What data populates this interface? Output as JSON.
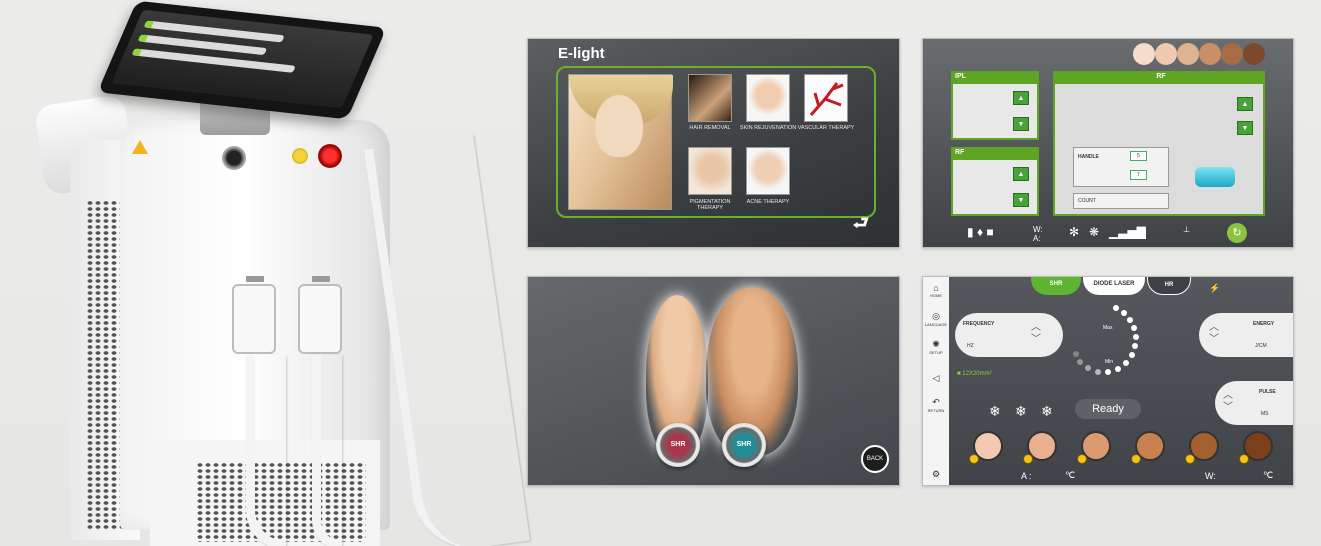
{
  "elight": {
    "title": "E-light",
    "treatments": [
      {
        "label": "HAIR REMOVAL"
      },
      {
        "label": "SKIN REJUVENATION"
      },
      {
        "label": "VASCULAR THERAPY"
      },
      {
        "label": "PIGMENTATION THERAPY"
      },
      {
        "label": "ACNE THERAPY"
      }
    ],
    "back_icon": "return-arrow-icon"
  },
  "iplrf": {
    "ipl_header": "IPL",
    "rf_header": "RF",
    "rf_main_header": "RF",
    "handle_label": "HANDLE",
    "handle_values": [
      "5",
      "7"
    ],
    "count_label": "COUNT",
    "skin_swatches": [
      "#f5dccb",
      "#efcaae",
      "#e0b390",
      "#c98f67",
      "#a66c45",
      "#7b4a2c"
    ],
    "accent": "#5ea524"
  },
  "body_select": {
    "buttons": [
      {
        "label": "SHR"
      },
      {
        "label": "SHR"
      }
    ],
    "back_label": "BACK"
  },
  "diode": {
    "tabs": [
      "SHR",
      "DIODE LASER",
      "HR"
    ],
    "side_menu": [
      "HOME",
      "LANGUAGE",
      "SETUP",
      "",
      "RETURN"
    ],
    "frequency_title": "FREQUENCY",
    "frequency_unit": "HZ",
    "energy_title": "ENERGY",
    "energy_unit": "J/CM",
    "pulse_title": "PULSE",
    "pulse_unit": "MS",
    "spot_size": "12X20mm²",
    "status": "Ready",
    "dial_max": "Max",
    "dial_min": "Min",
    "footer_a": "A :",
    "footer_c1": "℃",
    "footer_w": "W:",
    "footer_c2": "℃",
    "skin_tones": [
      "#f3c9b1",
      "#e9b08f",
      "#dc9a70",
      "#c9804f",
      "#a4602f",
      "#7b3f1b"
    ]
  }
}
